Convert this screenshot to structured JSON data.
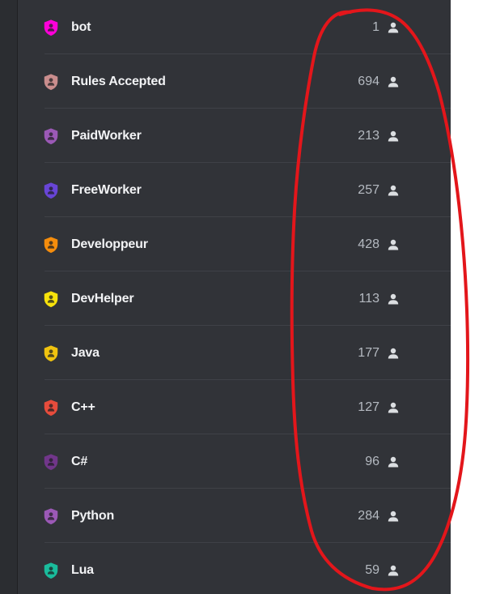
{
  "roles": [
    {
      "name": "bot",
      "count": "1",
      "color": "#ff00d9"
    },
    {
      "name": "Rules Accepted",
      "count": "694",
      "color": "#c98d8d"
    },
    {
      "name": "PaidWorker",
      "count": "213",
      "color": "#9b59b6"
    },
    {
      "name": "FreeWorker",
      "count": "257",
      "color": "#6845d6"
    },
    {
      "name": "Developpeur",
      "count": "428",
      "color": "#f58d0c"
    },
    {
      "name": "DevHelper",
      "count": "113",
      "color": "#f7e20b"
    },
    {
      "name": "Java",
      "count": "177",
      "color": "#f0c30f"
    },
    {
      "name": "C++",
      "count": "127",
      "color": "#e74c3c"
    },
    {
      "name": "C#",
      "count": "96",
      "color": "#71368a"
    },
    {
      "name": "Python",
      "count": "284",
      "color": "#9b59b6"
    },
    {
      "name": "Lua",
      "count": "59",
      "color": "#1abc9c"
    }
  ],
  "role_icon": "shield-person-icon",
  "member_icon": "person-icon",
  "annotation": {
    "color": "#e3161b",
    "shape": "hand-drawn-oval"
  }
}
